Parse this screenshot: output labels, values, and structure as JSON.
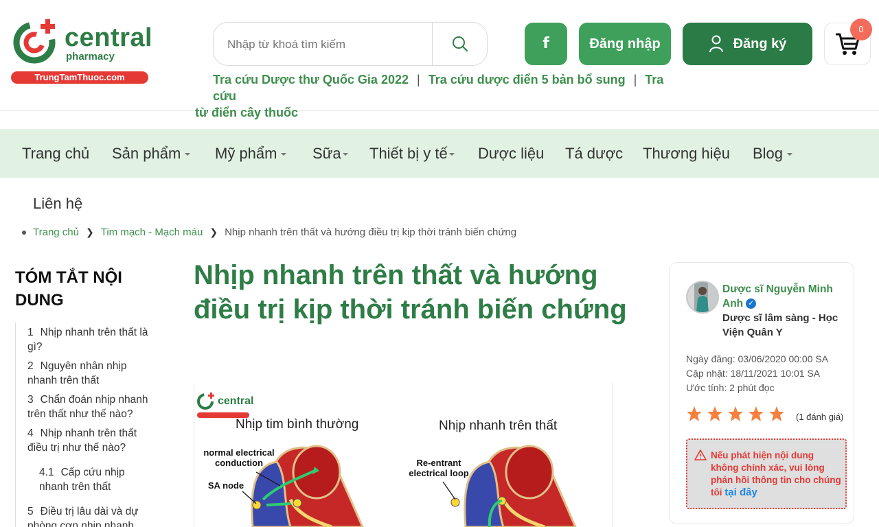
{
  "header": {
    "logo": {
      "word": "central",
      "sub": "pharmacy",
      "domain": "TrungTamThuoc.com"
    },
    "search": {
      "placeholder": "Nhập từ khoá tìm kiếm",
      "icon": "search-icon"
    },
    "facebook_label": "f",
    "login_label": "Đăng nhập",
    "register_label": "Đăng ký",
    "cart_count": "0",
    "quick_links": {
      "link1": "Tra cứu Dược thư Quốc Gia 2022",
      "sep1": "|",
      "link2": "Tra cứu dược điển 5 bản bổ sung",
      "sep2": "|",
      "link3a": "Tra cứu",
      "link3b": "từ điển cây thuốc"
    }
  },
  "nav": {
    "items": [
      {
        "label": "Trang chủ",
        "dropdown": false
      },
      {
        "label": "Sản phẩm",
        "dropdown": true
      },
      {
        "label": "Mỹ phẩm",
        "dropdown": true
      },
      {
        "label": "Sữa",
        "dropdown": true
      },
      {
        "label": "Thiết bị y tế",
        "dropdown": true
      },
      {
        "label": "Dược liệu",
        "dropdown": false
      },
      {
        "label": "Tá dược",
        "dropdown": false
      },
      {
        "label": "Thương hiệu",
        "dropdown": false
      },
      {
        "label": "Blog",
        "dropdown": true
      }
    ],
    "second_row": "Liên hệ"
  },
  "breadcrumb": {
    "home": "Trang chủ",
    "category": "Tim mạch - Mạch máu",
    "current": "Nhịp nhanh trên thất và hướng điều trị kịp thời tránh biến chứng"
  },
  "toc": {
    "title": "TÓM TẮT NỘI DUNG",
    "items": [
      {
        "num": "1",
        "text": "Nhịp nhanh trên thất là gì?"
      },
      {
        "num": "2",
        "text": "Nguyên nhân nhịp nhanh trên thất"
      },
      {
        "num": "3",
        "text": "Chẩn đoán nhịp nhanh trên thất như thế nào?"
      },
      {
        "num": "4",
        "text": "Nhịp nhanh trên thất điều trị như thế nào?"
      },
      {
        "num": "4.1",
        "text": "Cấp cứu nhịp nhanh trên thất"
      },
      {
        "num": "5",
        "text": "Điều trị lâu dài và dự phòng cơn nhịp nhanh"
      }
    ]
  },
  "article": {
    "title": "Nhịp nhanh trên thất và hướng điều trị kịp thời tránh biến chứng",
    "figure": {
      "logo_word": "central",
      "left_title": "Nhịp tim bình thường",
      "right_title": "Nhịp nhanh trên thất",
      "label_normal": "normal electrical conduction",
      "label_sa": "SA node",
      "label_reentrant": "Re-entrant electrical loop"
    }
  },
  "author": {
    "name": "Dược sĩ Nguyễn Minh Anh",
    "role": "Dược sĩ lâm sàng - Học Viện Quân Y",
    "published": "Ngày đăng: 03/06/2020 00:00 SA",
    "updated": "Cập nhật: 18/11/2021 10:01 SA",
    "reading_time": "Ước tính: 2 phút đọc",
    "rating": 5,
    "rating_count": "(1 đánh giá)",
    "report_text": "Nếu phát hiện nội dung không chính xác, vui lòng phản hồi thông tin cho chúng tôi",
    "report_link": "tại đây"
  },
  "colors": {
    "brand_green": "#2e7d46",
    "button_green": "#3ea05a",
    "dark_green": "#2a7b46",
    "nav_bg": "#e1f2e3",
    "accent_red": "#e53935",
    "star": "#f5813e"
  }
}
